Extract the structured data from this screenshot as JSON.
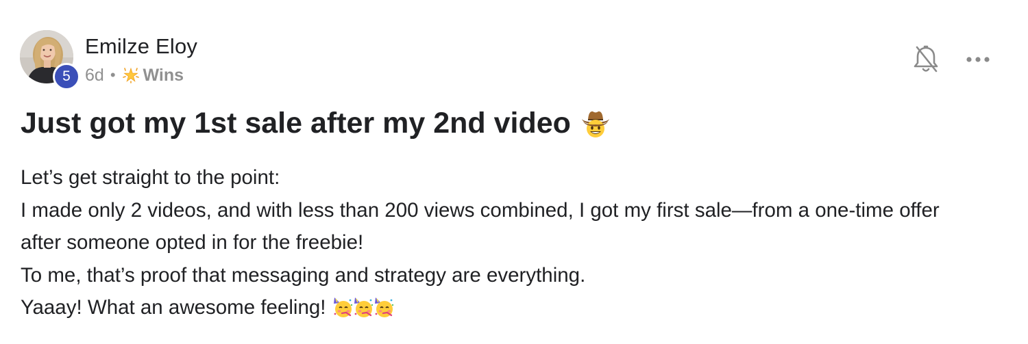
{
  "post": {
    "author": {
      "name": "Emilze Eloy",
      "level": "5",
      "avatar_icon": "profile-photo"
    },
    "meta": {
      "time": "6d",
      "separator": "•",
      "category_icon": "sparkle-star-icon",
      "category": "Wins"
    },
    "actions": {
      "notify_icon": "bell-off-icon",
      "more_icon": "more-horizontal-icon"
    },
    "title": "Just got my 1st sale after my 2nd video",
    "title_emoji": "cowboy-face-emoji",
    "body": [
      "Let’s get straight to the point:",
      "I made only 2 videos, and with less than 200 views combined, I got my first sale—from a one-time offer",
      "after someone opted in for the freebie!",
      "To me, that’s proof that messaging and strategy are everything.",
      "Yaaay! What an awesome feeling!"
    ],
    "body_emoji": [
      "partying-face-emoji",
      "partying-face-emoji",
      "partying-face-emoji"
    ]
  },
  "colors": {
    "badge": "#3b4fb8",
    "text": "#202124",
    "meta": "#909090"
  }
}
